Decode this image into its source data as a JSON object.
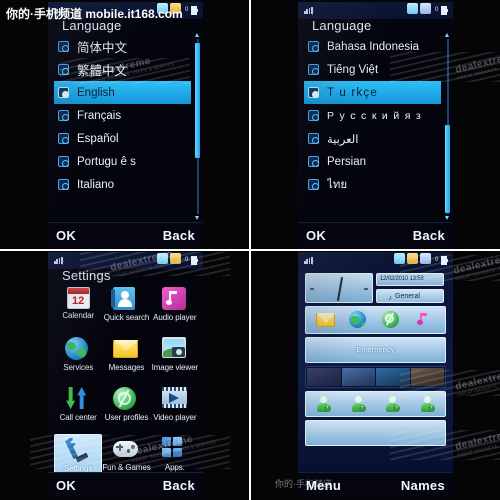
{
  "watermarks": {
    "top_banner": "你的·手机频道 mobile.it168.com",
    "brand": "dealextreme",
    "brand_sub": "GREAT GADGETS, PRICE & SERVICE",
    "bottom_overlay": "你的·手机频道"
  },
  "panels": {
    "top_left": {
      "name": "language-screen-latin",
      "title": "Language",
      "status": {
        "battery": "0",
        "signal_icon": "signal-bars-icon"
      },
      "items": [
        {
          "label": "简体中文",
          "selected": false,
          "script": "cjk"
        },
        {
          "label": "繁體中文",
          "selected": false,
          "script": "cjk"
        },
        {
          "label": "English",
          "selected": true,
          "script": "latin"
        },
        {
          "label": "Français",
          "selected": false,
          "script": "latin"
        },
        {
          "label": "Español",
          "selected": false,
          "script": "latin"
        },
        {
          "label": "Portugu ê s",
          "selected": false,
          "script": "latin"
        },
        {
          "label": "Italiano",
          "selected": false,
          "script": "latin"
        }
      ],
      "scroll": {
        "position": "top",
        "thumb_top_pct": 4,
        "thumb_height_pct": 62
      },
      "softkeys": {
        "left": "OK",
        "right": "Back"
      }
    },
    "top_right": {
      "name": "language-screen-other",
      "title": "Language",
      "status": {
        "battery": "0",
        "signal_icon": "signal-bars-icon"
      },
      "items": [
        {
          "label": "Bahasa Indonesia",
          "selected": false,
          "script": "latin"
        },
        {
          "label": "Tiếng Việt",
          "selected": false,
          "script": "latin"
        },
        {
          "label": "T u rkçe",
          "selected": true,
          "script": "wide"
        },
        {
          "label": "Р у с с к и й   я з",
          "selected": false,
          "script": "wide"
        },
        {
          "label": "العربية",
          "selected": false,
          "script": "rtl"
        },
        {
          "label": "Persian",
          "selected": false,
          "script": "latin"
        },
        {
          "label": "ไทย",
          "selected": false,
          "script": "latin"
        }
      ],
      "scroll": {
        "position": "bottom",
        "thumb_top_pct": 48,
        "thumb_height_pct": 48
      },
      "softkeys": {
        "left": "OK",
        "right": "Back"
      }
    },
    "bottom_left": {
      "name": "main-menu-screen",
      "title": "Settings",
      "status": {
        "battery": "0",
        "signal_icon": "signal-bars-icon"
      },
      "apps": [
        {
          "label": "Calendar",
          "icon": "calendar-icon",
          "day": "12",
          "selected": false
        },
        {
          "label": "Quick search",
          "icon": "contacts-book-icon",
          "selected": false
        },
        {
          "label": "Audio player",
          "icon": "music-note-icon",
          "selected": false
        },
        {
          "label": "Services",
          "icon": "globe-icon",
          "selected": false
        },
        {
          "label": "Messages",
          "icon": "envelope-icon",
          "selected": false
        },
        {
          "label": "Image viewer",
          "icon": "photo-camera-icon",
          "selected": false
        },
        {
          "label": "Call center",
          "icon": "call-arrows-icon",
          "selected": false
        },
        {
          "label": "User profiles",
          "icon": "profile-dial-icon",
          "selected": false
        },
        {
          "label": "Video player",
          "icon": "film-play-icon",
          "selected": false
        },
        {
          "label": "Settings",
          "icon": "wrench-icon",
          "selected": true
        },
        {
          "label": "Fun & Games",
          "icon": "gamepad-icon",
          "selected": false
        },
        {
          "label": "Apps.",
          "icon": "app-tiles-icon",
          "selected": false
        }
      ],
      "softkeys": {
        "left": "OK",
        "right": "Back"
      }
    },
    "bottom_right": {
      "name": "home-screen",
      "status": {
        "battery": "0",
        "signal_icon": "signal-bars-icon"
      },
      "widgets": {
        "clock": {
          "name": "analog-clock-widget"
        },
        "datetime": {
          "text": "12/02/2010  13:53"
        },
        "profile": {
          "text": "General",
          "icon": "music-note-icon"
        },
        "shortcuts": [
          {
            "name": "messages-shortcut",
            "icon": "envelope-icon"
          },
          {
            "name": "services-shortcut",
            "icon": "globe-icon"
          },
          {
            "name": "user-profiles-shortcut",
            "icon": "profile-dial-icon"
          },
          {
            "name": "audio-player-shortcut",
            "icon": "music-note-icon"
          }
        ],
        "emergency": {
          "label": "Emergency"
        },
        "photos": {
          "name": "photo-strip-widget",
          "count": 4
        },
        "contacts": {
          "name": "add-contact-widget",
          "count": 4
        }
      },
      "softkeys": {
        "left": "Menu",
        "right": "Names"
      }
    }
  },
  "colors": {
    "accent": "#1ea9e8",
    "screen_bg": "#04040c",
    "status_bg": "#0a1230",
    "text": "#e8f1ff",
    "selected_text": "#062034"
  }
}
